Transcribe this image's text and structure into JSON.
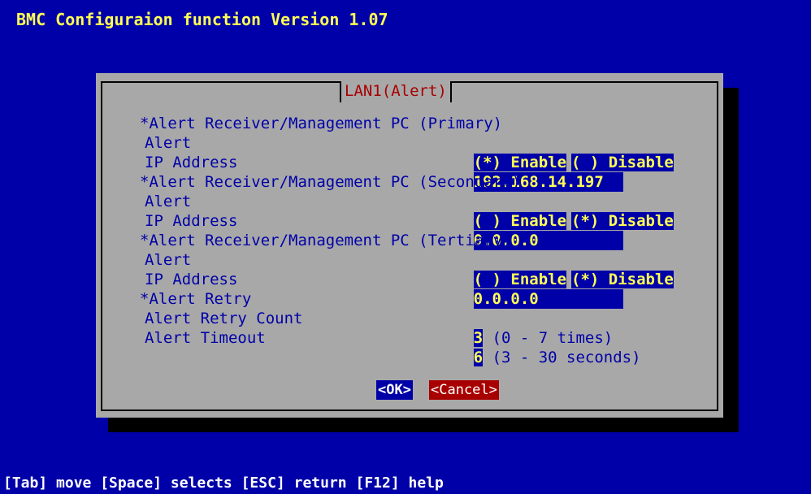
{
  "header": {
    "title": "BMC Configuraion function Version 1.07"
  },
  "dialog": {
    "title": "LAN1(Alert)",
    "sections": {
      "primary": {
        "heading": "*Alert Receiver/Management PC (Primary)",
        "alert_label": "Alert",
        "enable_option": "(*) Enable",
        "disable_option": "( ) Disable",
        "ip_label": "IP Address",
        "ip_value": "192.168.14.197"
      },
      "secondary": {
        "heading": "*Alert Receiver/Management PC (Secondary)",
        "alert_label": "Alert",
        "enable_option": "( ) Enable",
        "disable_option": "(*) Disable",
        "ip_label": "IP Address",
        "ip_value": "0.0.0.0"
      },
      "tertiary": {
        "heading": "*Alert Receiver/Management PC (Tertiary)",
        "alert_label": "Alert",
        "enable_option": "( ) Enable",
        "disable_option": "(*) Disable",
        "ip_label": "IP Address",
        "ip_value": "0.0.0.0"
      },
      "retry": {
        "heading": "*Alert Retry",
        "count_label": "Alert Retry Count",
        "count_value": "3",
        "count_range": " (0 - 7 times)",
        "timeout_label": "Alert Timeout",
        "timeout_value": "6",
        "timeout_range": " (3 - 30 seconds)"
      }
    },
    "buttons": {
      "ok": "<OK>",
      "cancel": "<Cancel>"
    }
  },
  "footer": {
    "help_text": "[Tab] move [Space] selects [ESC] return [F12] help"
  },
  "colors": {
    "background": "#0000a8",
    "dialog": "#a8a8a8",
    "accent_red": "#a80000",
    "highlight_yellow": "#ffff55"
  }
}
